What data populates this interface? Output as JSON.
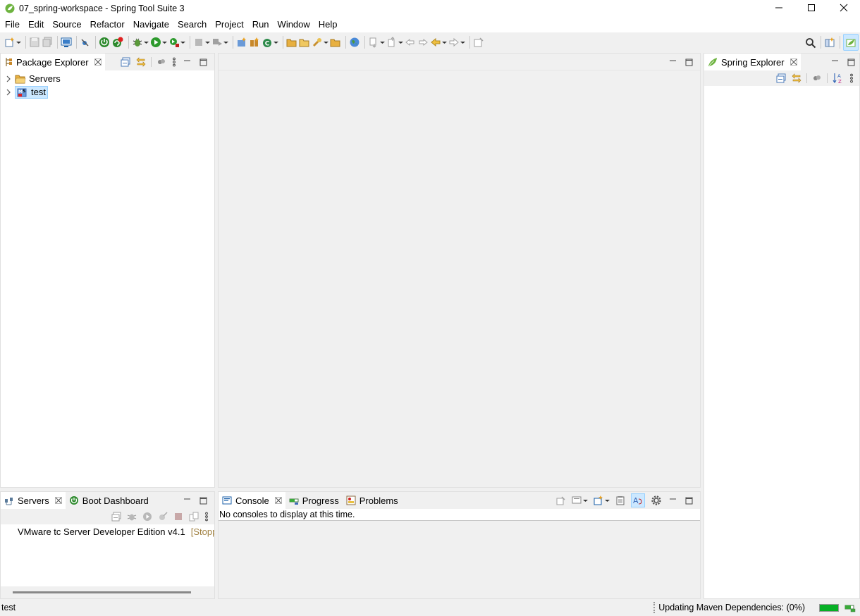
{
  "window": {
    "title": "07_spring-workspace - Spring Tool Suite 3"
  },
  "menu": [
    "File",
    "Edit",
    "Source",
    "Refactor",
    "Navigate",
    "Search",
    "Project",
    "Run",
    "Window",
    "Help"
  ],
  "package_explorer": {
    "tab_label": "Package Explorer",
    "items": [
      {
        "label": "Servers",
        "icon": "folder-icon"
      },
      {
        "label": "test",
        "icon": "maven-project-icon",
        "selected": true
      }
    ]
  },
  "spring_explorer": {
    "tab_label": "Spring Explorer"
  },
  "servers_view": {
    "tabs": [
      "Servers",
      "Boot Dashboard"
    ],
    "server_name": "VMware tc Server Developer Edition v4.1",
    "server_status": "[Stopp"
  },
  "console_view": {
    "tabs": [
      "Console",
      "Progress",
      "Problems"
    ],
    "message": "No consoles to display at this time."
  },
  "status": {
    "left_text": "test",
    "right_text": "Updating Maven Dependencies: (0%)",
    "progress": 0.0
  },
  "colors": {
    "selection": "#cce8ff",
    "progress": "#06b025",
    "spring_green": "#6db33f"
  }
}
